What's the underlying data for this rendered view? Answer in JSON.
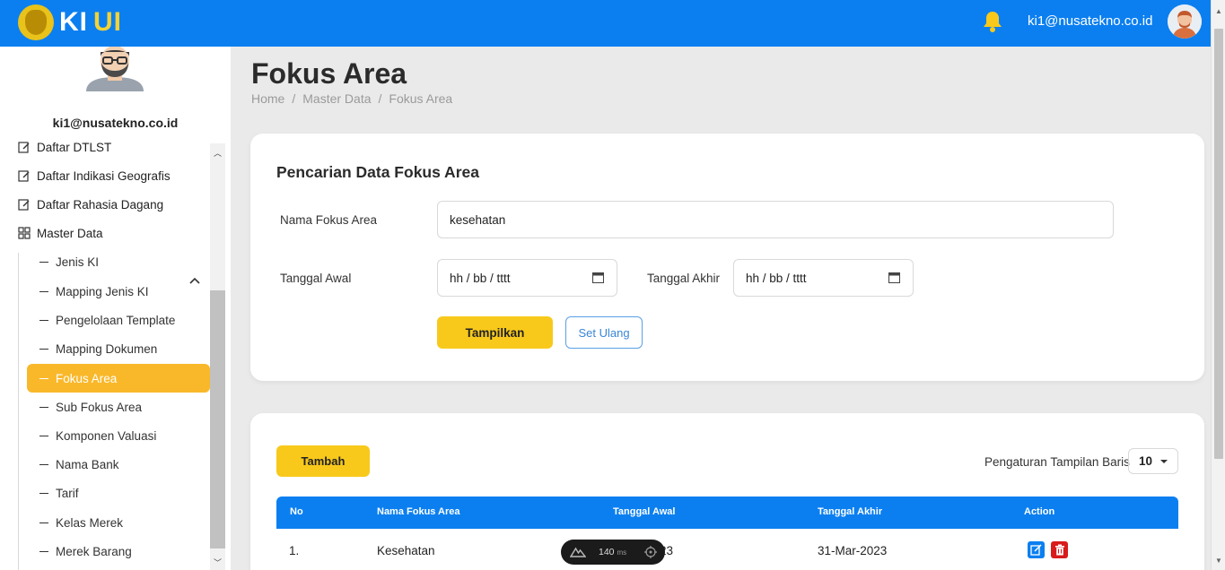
{
  "app": {
    "brand_main": "KI",
    "brand_accent": "UI"
  },
  "header": {
    "user_email": "ki1@nusatekno.co.id"
  },
  "sidebar": {
    "user_email": "ki1@nusatekno.co.id",
    "items": [
      {
        "label": "Daftar DTLST",
        "icon": "edit-icon"
      },
      {
        "label": "Daftar Indikasi Geografis",
        "icon": "edit-icon"
      },
      {
        "label": "Daftar Rahasia Dagang",
        "icon": "edit-icon"
      },
      {
        "label": "Master Data",
        "icon": "grid-icon",
        "expanded": true
      }
    ],
    "sub_items": [
      {
        "label": "Jenis KI"
      },
      {
        "label": "Mapping Jenis KI"
      },
      {
        "label": "Pengelolaan Template"
      },
      {
        "label": "Mapping Dokumen"
      },
      {
        "label": "Fokus Area",
        "active": true
      },
      {
        "label": "Sub Fokus Area"
      },
      {
        "label": "Komponen Valuasi"
      },
      {
        "label": "Nama Bank"
      },
      {
        "label": "Tarif"
      },
      {
        "label": "Kelas Merek"
      },
      {
        "label": "Merek Barang"
      }
    ]
  },
  "page": {
    "title": "Fokus Area",
    "breadcrumb": [
      "Home",
      "/",
      "Master Data",
      "/",
      "Fokus Area"
    ]
  },
  "search": {
    "title": "Pencarian Data Fokus Area",
    "name_label": "Nama Fokus Area",
    "name_value": "kesehatan",
    "start_label": "Tanggal Awal",
    "start_placeholder": "hh / bb / tttt",
    "end_label": "Tanggal Akhir",
    "end_placeholder": "hh / bb / tttt",
    "show_button": "Tampilkan",
    "reset_button": "Set Ulang"
  },
  "table": {
    "add_button": "Tambah",
    "rows_label": "Pengaturan Tampilan Baris",
    "rows_value": "10",
    "headers": [
      "No",
      "Nama Fokus Area",
      "Tanggal Awal",
      "Tanggal Akhir",
      "Action"
    ],
    "rows": [
      {
        "no": "1.",
        "name": "Kesehatan",
        "start": "23",
        "end": "31-Mar-2023"
      }
    ]
  },
  "devtools": {
    "ms_value": "140",
    "ms_unit": "ms"
  },
  "colors": {
    "primary": "#0b7ff0",
    "accent": "#f8c91b",
    "active_menu": "#f9b82a",
    "danger": "#d81b1b"
  }
}
